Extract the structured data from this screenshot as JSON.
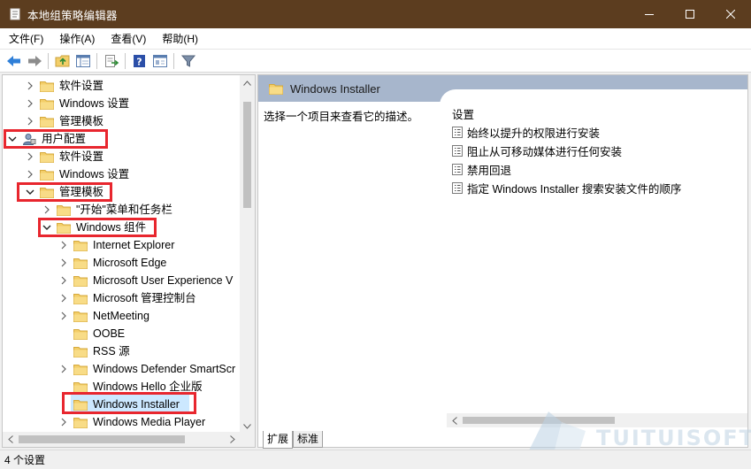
{
  "window": {
    "title": "本地组策略编辑器",
    "controls": [
      "minimize-icon",
      "maximize-icon",
      "close-icon"
    ]
  },
  "menu": [
    "文件(F)",
    "操作(A)",
    "查看(V)",
    "帮助(H)"
  ],
  "toolbar": [
    "back-arrow-icon",
    "forward-arrow-icon",
    "up-folder-icon",
    "show-tree-icon",
    "export-list-icon",
    "help-icon",
    "properties-icon",
    "filter-icon"
  ],
  "tree": {
    "items": [
      {
        "label": "软件设置",
        "expander": "collapsed"
      },
      {
        "label": "Windows 设置",
        "expander": "collapsed"
      },
      {
        "label": "管理模板",
        "expander": "collapsed"
      },
      {
        "label": "用户配置",
        "expander": "expanded",
        "icon": "user-config-icon"
      },
      {
        "label": "软件设置",
        "expander": "collapsed"
      },
      {
        "label": "Windows 设置",
        "expander": "collapsed"
      },
      {
        "label": "管理模板",
        "expander": "expanded"
      },
      {
        "label": "\"开始\"菜单和任务栏",
        "expander": "collapsed"
      },
      {
        "label": "Windows 组件",
        "expander": "expanded"
      },
      {
        "label": "Internet Explorer",
        "expander": "collapsed"
      },
      {
        "label": "Microsoft Edge",
        "expander": "collapsed"
      },
      {
        "label": "Microsoft User Experience V",
        "expander": "collapsed"
      },
      {
        "label": "Microsoft 管理控制台",
        "expander": "collapsed"
      },
      {
        "label": "NetMeeting",
        "expander": "collapsed"
      },
      {
        "label": "OOBE",
        "expander": "none"
      },
      {
        "label": "RSS 源",
        "expander": "none"
      },
      {
        "label": "Windows Defender SmartScr",
        "expander": "collapsed"
      },
      {
        "label": "Windows Hello 企业版",
        "expander": "none"
      },
      {
        "label": "Windows Installer",
        "expander": "none",
        "selected": true
      },
      {
        "label": "Windows Media Player",
        "expander": "collapsed"
      }
    ]
  },
  "details": {
    "header": "Windows Installer",
    "description": "选择一个项目来查看它的描述。",
    "settings_header": "设置",
    "settings": [
      "始终以提升的权限进行安装",
      "阻止从可移动媒体进行任何安装",
      "禁用回退",
      "指定 Windows Installer 搜索安装文件的顺序"
    ],
    "tabs": [
      "扩展",
      "标准"
    ]
  },
  "watermark": "TUITUISOFT",
  "status": "4 个设置",
  "colors": {
    "titlebar": "#5c3d1f",
    "header_band": "#a7b6cc",
    "highlight": "#e8262e",
    "selection": "#cce8ff",
    "folder": "#f3ce69"
  }
}
